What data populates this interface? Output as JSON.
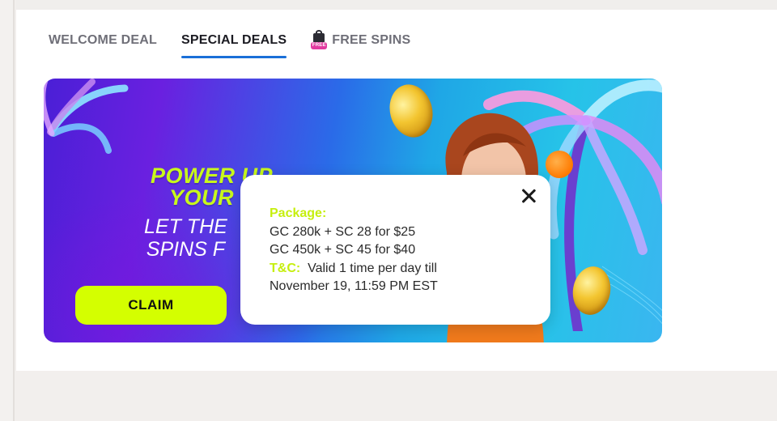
{
  "tabs": [
    {
      "label": "WELCOME DEAL",
      "active": false
    },
    {
      "label": "SPECIAL DEALS",
      "active": true
    },
    {
      "label": "FREE SPINS",
      "active": false,
      "icon": "gift-free-icon",
      "icon_text": "FREE"
    }
  ],
  "banner": {
    "headline_line1": "POWER UP",
    "headline_line2": "YOUR F",
    "subline_line1": "LET THE",
    "subline_line2": "SPINS F",
    "claim_label": "CLAIM"
  },
  "popup": {
    "package_label": "Package:",
    "package_line1": "GC 280k + SC 28 for $25",
    "package_line2": "GC 450k + SC 45 for $40",
    "tc_label": "T&C:",
    "tc_text": "Valid 1 time per day till",
    "tc_line2": "November 19, 11:59 PM EST"
  },
  "colors": {
    "accent_lime": "#d4ff00",
    "tab_underline": "#1a6fd8",
    "highlight_text": "#c6ef0e"
  }
}
